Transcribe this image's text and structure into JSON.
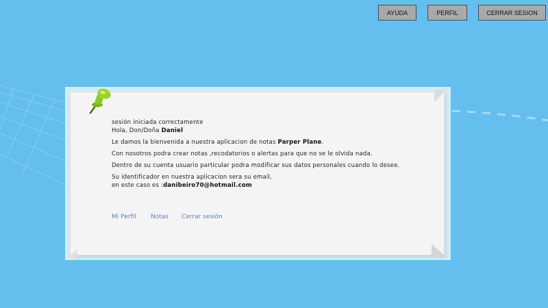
{
  "header": {
    "buttons": {
      "help": "AYUDA",
      "profile": "PERFIL",
      "logout": "CERRAR SESION"
    }
  },
  "note": {
    "session_started": "sesión iniciada correctamente",
    "greeting_prefix": "Hola, Don/Doña ",
    "user_name": "Daniel",
    "welcome_prefix": "Le damos la bienvenida a nuestra aplicacion de notas ",
    "app_name": "Parper Plane",
    "welcome_suffix": ".",
    "line_create": "Con nosotros podra crear notas ,recodatorios o alertas para que no se le olvida nada.",
    "line_account": "Dentro de su cuenta usuario particular podra modificar sus datos personales cuando lo desee.",
    "id_line1": "Su identificador en nuestra aplicacion sera su email,",
    "id_line2_prefix": "en este caso es :",
    "email": "danibeiro70@hotmail.com"
  },
  "links": {
    "profile": "Mi Perfil",
    "notes": "Notas",
    "logout": "Cerrar sesión"
  },
  "colors": {
    "background": "#64bfee",
    "note_frame": "#d3ebf8",
    "paper": "#f4f4f4",
    "link": "#5b7fa8",
    "pin": "#8ac926"
  },
  "icons": {
    "pin": "pushpin-icon"
  }
}
